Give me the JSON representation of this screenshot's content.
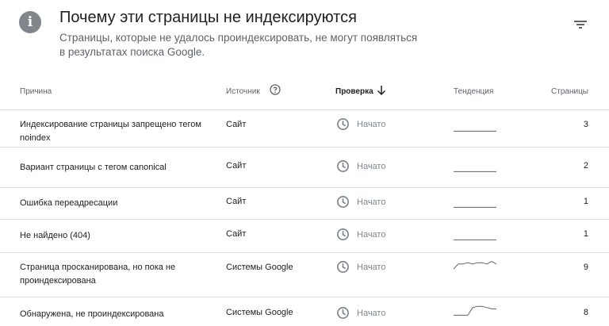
{
  "header": {
    "title": "Почему эти страницы не индексируются",
    "subtitle": "Страницы, которые не удалось проиндексировать, не могут появляться в результатах поиска Google."
  },
  "icons": {
    "info": "info-icon",
    "filter": "filter-icon",
    "help": "help-circle-icon",
    "sort": "arrow-down-icon",
    "status": "clock-icon"
  },
  "columns": {
    "reason": "Причина",
    "source": "Источник",
    "check": "Проверка",
    "trend": "Тенденция",
    "pages": "Страницы"
  },
  "rows": [
    {
      "reason": "Индексирование страницы запрещено тегом noindex",
      "source": "Сайт",
      "status": "Начато",
      "pages": "3",
      "trend": [
        1,
        1,
        1,
        1,
        1,
        1,
        1,
        1,
        1,
        1
      ]
    },
    {
      "reason": "Вариант страницы с тегом canonical",
      "source": "Сайт",
      "status": "Начато",
      "pages": "2",
      "trend": [
        1,
        1,
        1,
        1,
        1,
        1,
        1,
        1,
        1,
        1
      ]
    },
    {
      "reason": "Ошибка переадресации",
      "source": "Сайт",
      "status": "Начато",
      "pages": "1",
      "trend": [
        1,
        1,
        1,
        1,
        1,
        1,
        1,
        1,
        1,
        1
      ]
    },
    {
      "reason": "Не найдено (404)",
      "source": "Сайт",
      "status": "Начато",
      "pages": "1",
      "trend": [
        1,
        1,
        1,
        1,
        1,
        1,
        1,
        1,
        1,
        1
      ]
    },
    {
      "reason": "Страница просканирована, но пока не проиндексирована",
      "source": "Системы Google",
      "status": "Начато",
      "pages": "9",
      "trend": [
        3,
        7,
        7,
        8,
        7,
        8,
        8,
        7,
        9,
        7
      ]
    },
    {
      "reason": "Обнаружена, не проиндексирована",
      "source": "Системы Google",
      "status": "Начато",
      "pages": "8",
      "trend": [
        1,
        1,
        1,
        1,
        7,
        8,
        8,
        7,
        6,
        6
      ]
    }
  ],
  "colors": {
    "text": "#202124",
    "muted": "#5f6368",
    "icon": "#80868b",
    "divider": "#e0e0e0"
  }
}
